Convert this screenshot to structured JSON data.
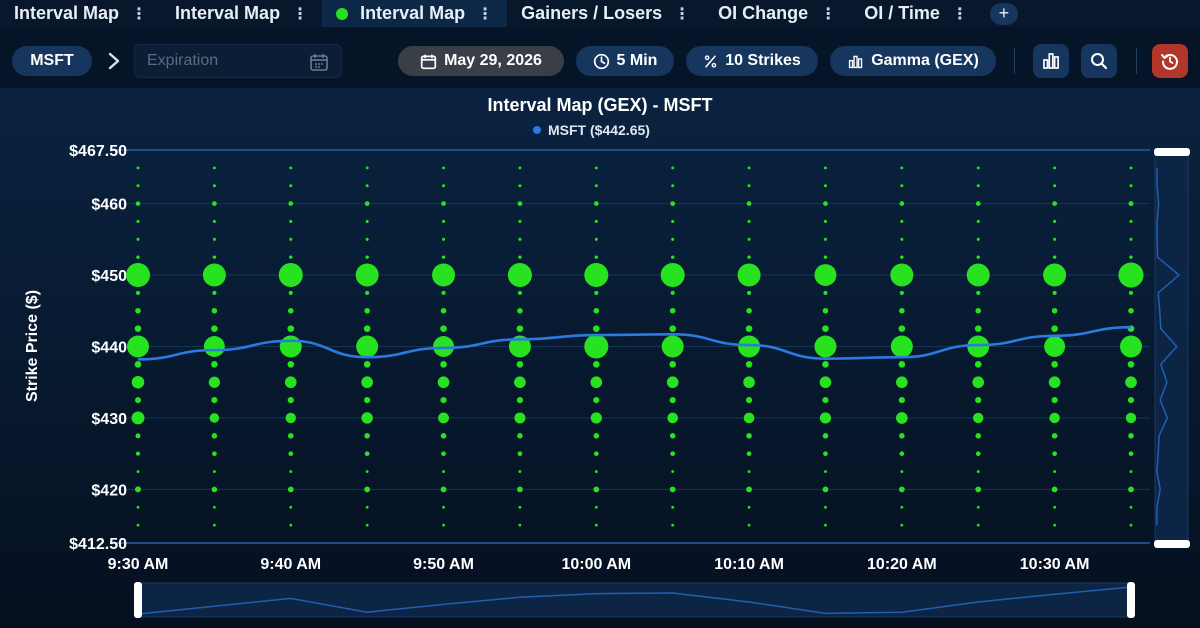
{
  "tabs": [
    {
      "label": "Interval Map",
      "active": false
    },
    {
      "label": "Interval Map",
      "active": false
    },
    {
      "label": "Interval Map",
      "active": true
    },
    {
      "label": "Gainers / Losers",
      "active": false
    },
    {
      "label": "OI Change",
      "active": false
    },
    {
      "label": "OI / Time",
      "active": false
    }
  ],
  "tab_add_label": "+",
  "kebab_glyph": "⋮",
  "toolbar": {
    "symbol": "MSFT",
    "expiration_placeholder": "Expiration",
    "date": "May 29, 2026",
    "interval": "5 Min",
    "strikes": "10 Strikes",
    "metric": "Gamma (GEX)"
  },
  "colors": {
    "accent": "#16365e",
    "bubble": "#27e21f",
    "price_line": "#2a7ae2",
    "background": "#061427",
    "reset": "#b3362b"
  },
  "chart_data": {
    "type": "scatter",
    "title": "Interval Map (GEX) - MSFT",
    "legend": "MSFT ($442.65)",
    "ylabel": "Strike Price ($)",
    "ylim": [
      412.5,
      467.5
    ],
    "yticks": [
      "$467.50",
      "$460",
      "$450",
      "$440",
      "$430",
      "$420",
      "$412.50"
    ],
    "ytick_values": [
      467.5,
      460,
      450,
      440,
      430,
      420,
      412.5
    ],
    "x": [
      "9:30 AM",
      "9:35 AM",
      "9:40 AM",
      "9:45 AM",
      "9:50 AM",
      "9:55 AM",
      "10:00 AM",
      "10:05 AM",
      "10:10 AM",
      "10:15 AM",
      "10:20 AM",
      "10:25 AM",
      "10:30 AM",
      "10:35 AM"
    ],
    "xticks": [
      "9:30 AM",
      "9:40 AM",
      "9:50 AM",
      "10:00 AM",
      "10:10 AM",
      "10:20 AM",
      "10:30 AM"
    ],
    "strikes": [
      415,
      417.5,
      420,
      422.5,
      425,
      427.5,
      430,
      432.5,
      435,
      437.5,
      440,
      442.5,
      445,
      447.5,
      450,
      452.5,
      455,
      457.5,
      460,
      462.5,
      465
    ],
    "gex_magnitude": [
      [
        0.4,
        0.4,
        0.4,
        0.4,
        0.4,
        0.4,
        0.4,
        0.4,
        0.4,
        0.4,
        0.4,
        0.4,
        0.4,
        0.4
      ],
      [
        0.4,
        0.4,
        0.4,
        0.4,
        0.4,
        0.4,
        0.4,
        0.4,
        0.4,
        0.4,
        0.4,
        0.4,
        0.4,
        0.4
      ],
      [
        1.9,
        1.7,
        1.8,
        1.8,
        1.8,
        1.8,
        1.8,
        1.8,
        1.8,
        1.8,
        1.8,
        1.8,
        1.8,
        1.8
      ],
      [
        0.4,
        0.4,
        0.4,
        0.4,
        0.4,
        0.4,
        0.4,
        0.4,
        0.4,
        0.4,
        0.4,
        0.4,
        0.4,
        0.4
      ],
      [
        1.0,
        1.3,
        1.3,
        1.3,
        1.3,
        1.3,
        1.3,
        1.3,
        1.3,
        1.3,
        1.3,
        1.3,
        1.3,
        1.3
      ],
      [
        1.4,
        1.7,
        1.7,
        1.7,
        1.7,
        1.7,
        1.7,
        1.7,
        1.7,
        1.7,
        1.7,
        1.7,
        1.7,
        1.7
      ],
      [
        5.2,
        3.6,
        4.0,
        4.5,
        4.2,
        4.3,
        4.4,
        4.1,
        4.1,
        4.4,
        4.6,
        4.0,
        4.0,
        4.0
      ],
      [
        1.9,
        2.0,
        2.0,
        2.0,
        2.0,
        2.0,
        2.0,
        2.0,
        2.0,
        2.0,
        2.0,
        2.0,
        2.0,
        2.0
      ],
      [
        5.0,
        4.4,
        4.6,
        4.6,
        4.6,
        4.6,
        4.6,
        4.6,
        4.6,
        4.6,
        4.6,
        4.6,
        4.6,
        4.6
      ],
      [
        2.2,
        2.2,
        2.2,
        2.2,
        2.2,
        2.2,
        2.2,
        2.2,
        2.2,
        2.2,
        2.2,
        2.2,
        2.2,
        2.2
      ],
      [
        9.5,
        9.0,
        9.5,
        9.5,
        9.0,
        9.5,
        10.5,
        9.5,
        9.5,
        9.5,
        9.5,
        9.5,
        9.0,
        9.5
      ],
      [
        2.2,
        2.2,
        2.2,
        2.2,
        2.2,
        2.2,
        2.2,
        2.2,
        2.2,
        2.2,
        2.2,
        2.2,
        2.2,
        2.2
      ],
      [
        1.7,
        1.7,
        1.7,
        1.7,
        1.7,
        1.7,
        1.7,
        1.7,
        1.7,
        1.7,
        1.7,
        1.7,
        1.7,
        1.7
      ],
      [
        1.0,
        1.0,
        1.0,
        1.0,
        1.0,
        1.0,
        1.0,
        1.0,
        1.0,
        1.0,
        1.0,
        1.0,
        1.0,
        1.0
      ],
      [
        10.5,
        10.0,
        10.5,
        10.0,
        10.0,
        10.5,
        10.5,
        10.5,
        10.0,
        9.5,
        10.0,
        10.0,
        10.0,
        11.0
      ],
      [
        0.7,
        0.7,
        0.7,
        0.7,
        0.7,
        0.7,
        0.7,
        0.7,
        0.7,
        0.7,
        0.7,
        0.7,
        0.7,
        0.7
      ],
      [
        0.5,
        0.5,
        0.5,
        0.5,
        0.5,
        0.5,
        0.5,
        0.5,
        0.5,
        0.5,
        0.5,
        0.5,
        0.5,
        0.5
      ],
      [
        0.5,
        0.5,
        0.5,
        0.5,
        0.5,
        0.5,
        0.5,
        0.5,
        0.5,
        0.5,
        0.5,
        0.5,
        0.5,
        0.5
      ],
      [
        1.2,
        1.3,
        1.3,
        1.3,
        1.3,
        1.3,
        1.3,
        1.3,
        1.3,
        1.3,
        1.3,
        1.3,
        1.3,
        1.4
      ],
      [
        0.5,
        0.5,
        0.5,
        0.5,
        0.5,
        0.5,
        0.5,
        0.5,
        0.5,
        0.5,
        0.5,
        0.5,
        0.5,
        0.5
      ],
      [
        0.4,
        0.4,
        0.4,
        0.4,
        0.4,
        0.4,
        0.4,
        0.4,
        0.4,
        0.4,
        0.4,
        0.4,
        0.4,
        0.4
      ]
    ],
    "price": [
      438.2,
      439.5,
      440.8,
      438.5,
      439.8,
      441.0,
      441.6,
      441.7,
      440.2,
      438.3,
      438.5,
      440.2,
      441.5,
      442.7
    ],
    "grid": true,
    "legend_position": "top-center"
  }
}
